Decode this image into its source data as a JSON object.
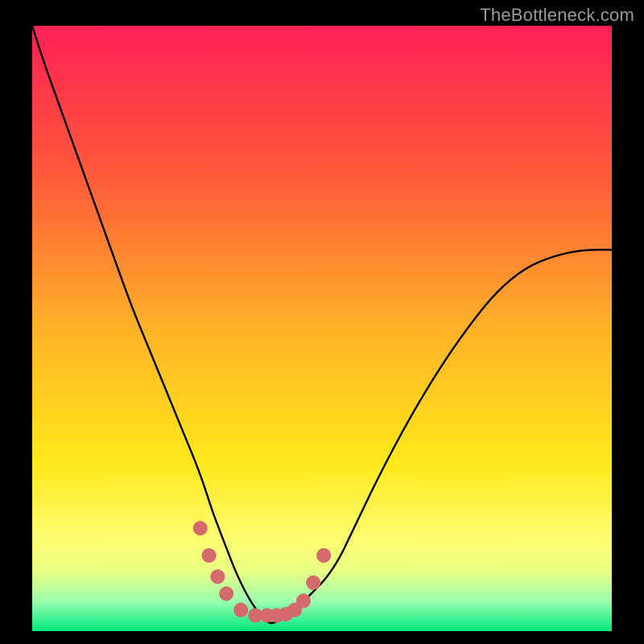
{
  "attribution": "TheBottleneck.com",
  "chart_data": {
    "type": "line",
    "title": "",
    "xlabel": "",
    "ylabel": "",
    "xlim": [
      0,
      100
    ],
    "ylim": [
      0,
      100
    ],
    "grid": false,
    "legend": false,
    "gradient_stops": [
      {
        "pos": 0.0,
        "color": "#ff1f55"
      },
      {
        "pos": 0.25,
        "color": "#ff5a3a"
      },
      {
        "pos": 0.5,
        "color": "#ffb227"
      },
      {
        "pos": 0.72,
        "color": "#ffe81a"
      },
      {
        "pos": 0.84,
        "color": "#fffb6b"
      },
      {
        "pos": 0.9,
        "color": "#e9ff82"
      },
      {
        "pos": 0.95,
        "color": "#9dffb0"
      },
      {
        "pos": 1.0,
        "color": "#00e77d"
      }
    ],
    "series": [
      {
        "name": "bottleneck-curve",
        "x": [
          0,
          2,
          5,
          8,
          11,
          14,
          17,
          20,
          23,
          26,
          29,
          31,
          33,
          35,
          37,
          39,
          41,
          43,
          47,
          52,
          56,
          60,
          65,
          70,
          75,
          80,
          85,
          90,
          95,
          100
        ],
        "y": [
          100,
          94,
          86,
          78,
          70,
          62,
          54,
          47,
          40,
          33,
          26,
          20,
          15,
          10,
          6,
          3,
          1,
          2,
          5,
          10,
          18,
          26,
          35,
          43,
          50,
          56,
          60,
          62,
          63,
          63
        ]
      }
    ],
    "markers": {
      "name": "highlight-points",
      "color": "#d56a6c",
      "radius": 9,
      "x": [
        29.0,
        30.5,
        32.0,
        33.5,
        36.0,
        38.5,
        40.5,
        42.2,
        43.8,
        45.3,
        46.8,
        48.5,
        50.3
      ],
      "y": [
        17.0,
        12.5,
        9.0,
        6.2,
        3.5,
        2.6,
        2.6,
        2.6,
        2.8,
        3.5,
        5.0,
        8.0,
        12.5
      ]
    }
  }
}
